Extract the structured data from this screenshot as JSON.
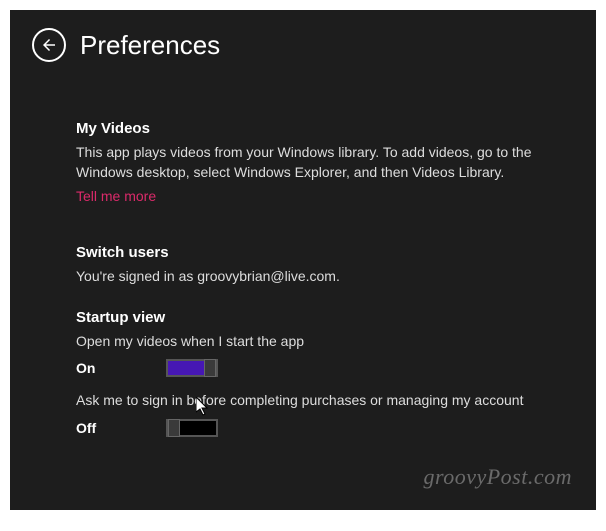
{
  "header": {
    "title": "Preferences"
  },
  "sections": {
    "myVideos": {
      "heading": "My Videos",
      "description": "This app plays videos from your Windows library. To add videos, go to the Windows desktop, select Windows Explorer, and then Videos Library.",
      "linkText": "Tell me more"
    },
    "switchUsers": {
      "heading": "Switch users",
      "description": "You're signed in as groovybrian@live.com."
    },
    "startupView": {
      "heading": "Startup view",
      "setting1": {
        "label": "Open my videos when I start the app",
        "state": "On",
        "value": true
      },
      "setting2": {
        "label": "Ask me to sign in before completing purchases or managing my account",
        "state": "Off",
        "value": false
      }
    }
  },
  "watermark": "groovyPost.com"
}
